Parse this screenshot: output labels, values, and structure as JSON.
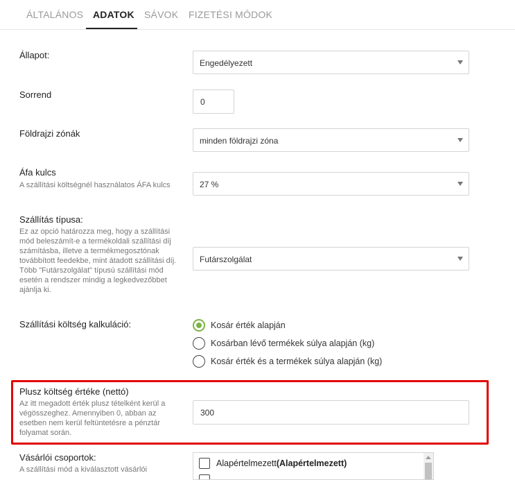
{
  "tabs": [
    {
      "label": "ÁLTALÁNOS"
    },
    {
      "label": "ADATOK",
      "active": true
    },
    {
      "label": "SÁVOK"
    },
    {
      "label": "FIZETÉSI MÓDOK"
    }
  ],
  "status": {
    "label": "Állapot:",
    "value": "Engedélyezett"
  },
  "order": {
    "label": "Sorrend",
    "value": "0"
  },
  "geo_zones": {
    "label": "Földrajzi zónák",
    "value": "minden földrajzi zóna"
  },
  "vat": {
    "label": "Áfa kulcs",
    "help": "A szállítási költségnél használatos ÁFA kulcs",
    "value": "27 %"
  },
  "shipping_type": {
    "label": "Szállítás típusa:",
    "help": "Ez az opció határozza meg, hogy a szállítási mód beleszámít-e a termékoldali szállítási díj számításba, illetve a termékmegosztónak továbbított feedekbe, mint átadott szállítási díj. Több \"Futárszolgálat\" típusú szállítási mód esetén a rendszer mindig a legkedvezőbbet ajánlja ki.",
    "value": "Futárszolgálat"
  },
  "cost_calc": {
    "label": "Szállítási költség kalkuláció:",
    "options": [
      {
        "label": "Kosár érték alapján",
        "checked": true
      },
      {
        "label": "Kosárban lévő termékek súlya alapján (kg)",
        "checked": false
      },
      {
        "label": "Kosár érték és a termékek súlya alapján (kg)",
        "checked": false
      }
    ]
  },
  "extra_cost": {
    "label": "Plusz költség értéke (nettó)",
    "help": "Az itt megadott érték plusz tételként kerül a végösszeghez. Amennyiben 0, abban az esetben nem kerül feltüntetésre a pénztár folyamat során.",
    "value": "300"
  },
  "customer_groups": {
    "label": "Vásárlói csoportok:",
    "help": "A szállítási mód a kiválasztott vásárlói",
    "items": [
      {
        "label_plain": "Alapértelmezett",
        "label_bold": "(Alapértelmezett)"
      }
    ]
  },
  "colors": {
    "highlight": "#e10000",
    "radio_checked": "#7cb342"
  }
}
